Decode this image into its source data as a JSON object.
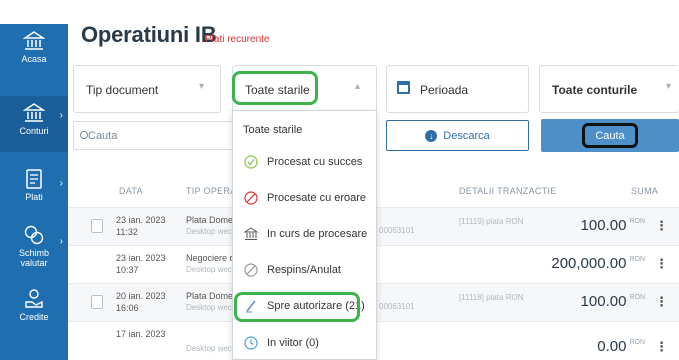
{
  "sidebar": {
    "items": [
      {
        "label": "Acasa",
        "icon": "bank-icon"
      },
      {
        "label": "Conturi",
        "icon": "bank-icon"
      },
      {
        "label": "Plati",
        "icon": "payments-icon"
      },
      {
        "label": "Schimb\nvalutar",
        "label1": "Schimb",
        "label2": "valutar",
        "icon": "currency-exchange-icon"
      },
      {
        "label": "Credite",
        "icon": "credit-icon"
      }
    ]
  },
  "header": {
    "title": "Operatiuni IB",
    "subtitle": "Plati recurente"
  },
  "filters": {
    "document_type": "Tip document",
    "status": "Toate starile",
    "period": "Perioada",
    "accounts": "Toate conturile"
  },
  "search": {
    "placeholder": "Cauta"
  },
  "buttons": {
    "download": "Descarca",
    "search": "Cauta"
  },
  "table": {
    "headers": {
      "date": "DATA",
      "type": "TIP OPERATI",
      "details": "DETALII TRANZACTIE",
      "amount": "SUMA"
    },
    "rows": [
      {
        "date": "23 ian. 2023",
        "time": "11:32",
        "type": "Plata Domes",
        "channel": "Desktop wec",
        "account": "00063101",
        "details": "[11119] plata RON",
        "amount": "100.00",
        "currency": "RON",
        "checkbox": true
      },
      {
        "date": "23 ian. 2023",
        "time": "10:37",
        "type": "Negociere de",
        "channel": "Desktop wec",
        "account": "",
        "details": "",
        "amount": "200,000.00",
        "currency": "RON",
        "checkbox": false
      },
      {
        "date": "20 ian. 2023",
        "time": "16:06",
        "type": "Plata Domes",
        "channel": "Desktop wec",
        "account": "00063101",
        "details": "[11118] plata RON",
        "amount": "100.00",
        "currency": "RON",
        "checkbox": true
      },
      {
        "date": "17 ian. 2023",
        "time": "",
        "type": "",
        "channel": "Desktop wec",
        "account": "",
        "details": "",
        "amount": "0.00",
        "currency": "RON",
        "checkbox": false
      }
    ]
  },
  "status_dropdown": {
    "items": [
      {
        "label": "Toate starile",
        "icon": ""
      },
      {
        "label": "Procesat cu succes",
        "icon": "check-circle-icon"
      },
      {
        "label": "Procesate cu eroare",
        "icon": "error-circle-icon"
      },
      {
        "label": "In curs de procesare",
        "icon": "bank-icon"
      },
      {
        "label": "Respins/Anulat",
        "icon": "cancel-icon"
      },
      {
        "label": "Spre autorizare (21)",
        "icon": "pen-icon"
      },
      {
        "label": "In viitor (0)",
        "icon": "clock-icon"
      }
    ]
  },
  "colors": {
    "sidebar": "#1f6fb0",
    "accent": "#2f6fa8",
    "highlight_green": "#3cb44b",
    "subtitle_red": "#e03131",
    "search_button": "#4d8fc9"
  }
}
